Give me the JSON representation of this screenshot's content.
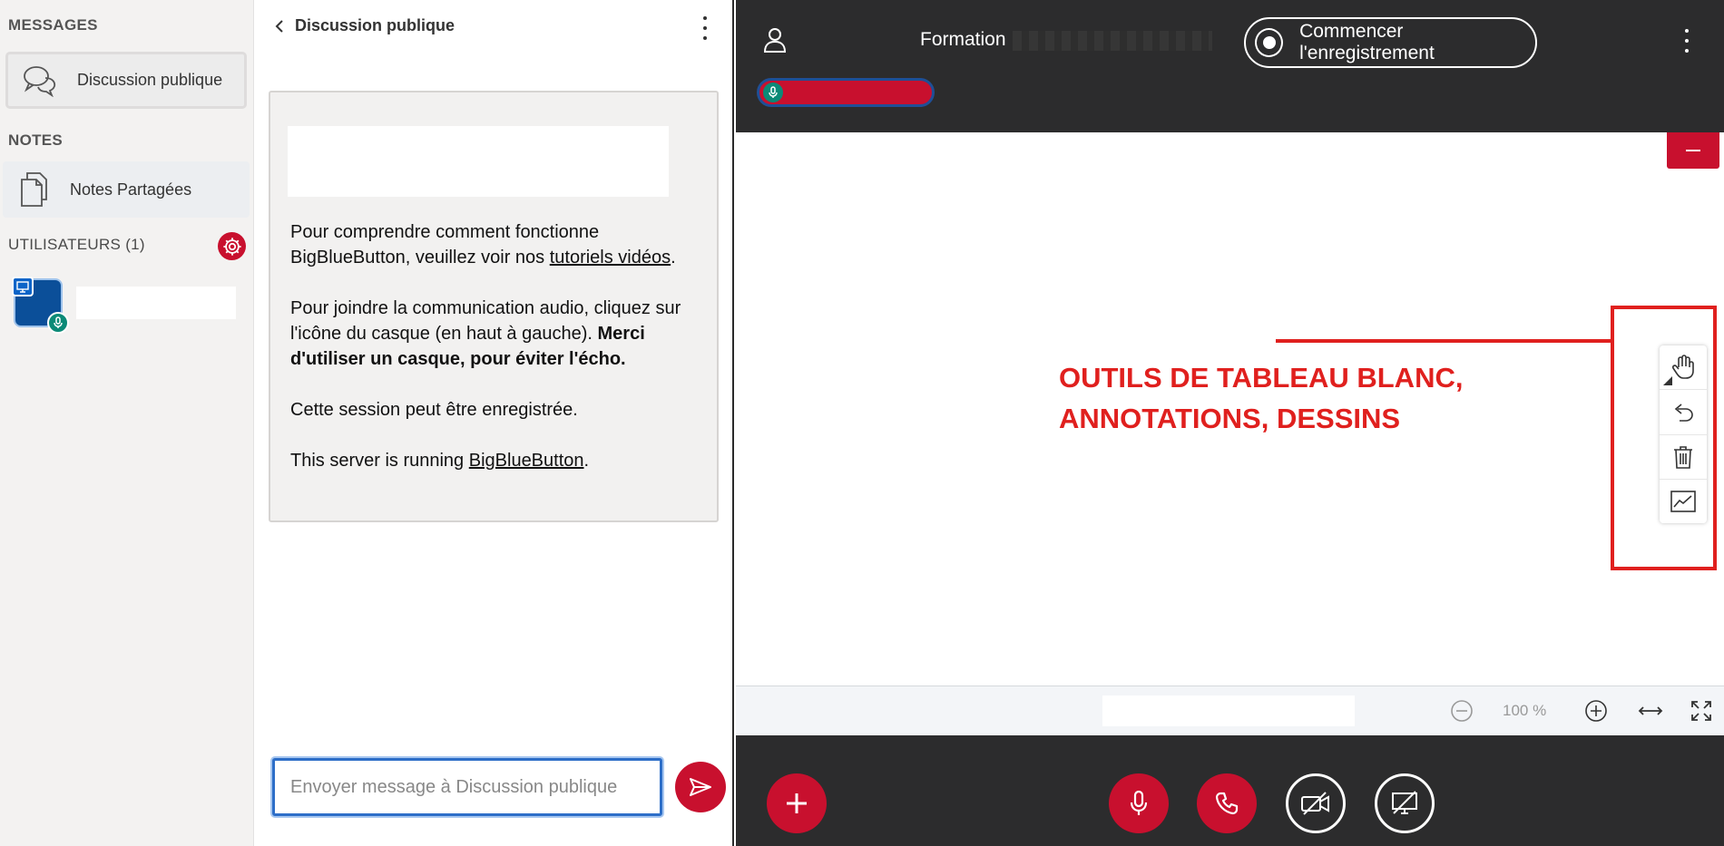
{
  "sidebar": {
    "messages_title": "MESSAGES",
    "public_chat_label": "Discussion publique",
    "notes_title": "NOTES",
    "shared_notes_label": "Notes Partagées",
    "users_title": "UTILISATEURS (1)"
  },
  "chat": {
    "header_title": "Discussion publique",
    "welcome": {
      "p1_pre": "Pour comprendre comment fonctionne BigBlueButton, veuillez voir nos ",
      "p1_link": "tutoriels vidéos",
      "p1_post": ".",
      "p2_pre": "Pour joindre la communication audio, cliquez sur l'icône du casque (en haut à gauche). ",
      "p2_bold": "Merci d'utiliser un casque, pour éviter l'écho.",
      "p3": "Cette session peut être enregistrée.",
      "p4_pre": "This server is running ",
      "p4_link": "BigBlueButton",
      "p4_post": "."
    },
    "input_placeholder": "Envoyer message à Discussion publique"
  },
  "main": {
    "meeting_title": "Formation",
    "record_label": "Commencer l'enregistrement",
    "annotation_line1": "OUTILS DE TABLEAU BLANC,",
    "annotation_line2": "ANNOTATIONS, DESSINS",
    "zoom_level": "100 %"
  },
  "colors": {
    "accent_red": "#c8102e",
    "annotation_red": "#e0201e",
    "dark_bg": "#2c2c2d",
    "focus_blue": "#2d6ec8",
    "mic_green": "#0b8a77"
  },
  "icons": {
    "public_chat": "chat-bubbles-icon",
    "shared_notes": "document-copy-icon",
    "users_settings": "gear-icon",
    "whiteboard_tools": [
      "hand-icon",
      "undo-icon",
      "trash-icon",
      "multi-user-whiteboard-icon"
    ],
    "slide_controls": [
      "zoom-out-icon",
      "zoom-in-icon",
      "fit-width-icon",
      "fullscreen-icon"
    ],
    "actions": [
      "plus-icon",
      "microphone-icon",
      "phone-icon",
      "camera-off-icon",
      "screenshare-off-icon"
    ]
  }
}
